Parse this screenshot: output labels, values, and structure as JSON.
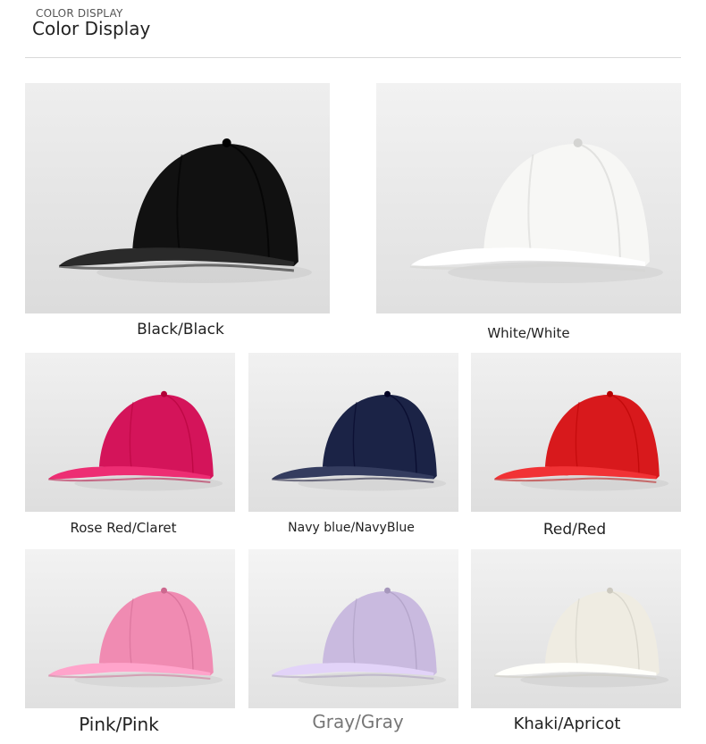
{
  "header": {
    "subtitle": "COLOR DISPLAY",
    "title": "Color Display"
  },
  "products": [
    {
      "label": "Black/Black",
      "color": "#111111",
      "bg": "#e6e6e6"
    },
    {
      "label": "White/White",
      "color": "#f7f7f5",
      "bg": "#eaeaea"
    },
    {
      "label": "Rose Red/Claret",
      "color": "#d4145a",
      "bg": "#e8e8e8"
    },
    {
      "label": "Navy blue/NavyBlue",
      "color": "#1b2346",
      "bg": "#e9e9e9"
    },
    {
      "label": "Red/Red",
      "color": "#d8191c",
      "bg": "#e8e8e8"
    },
    {
      "label": "Pink/Pink",
      "color": "#f08bb2",
      "bg": "#eaeaea"
    },
    {
      "label": "Gray/Gray",
      "color": "#c9badf",
      "bg": "#ececec"
    },
    {
      "label": "Khaki/Apricot",
      "color": "#efece2",
      "bg": "#e9e9e9"
    }
  ]
}
